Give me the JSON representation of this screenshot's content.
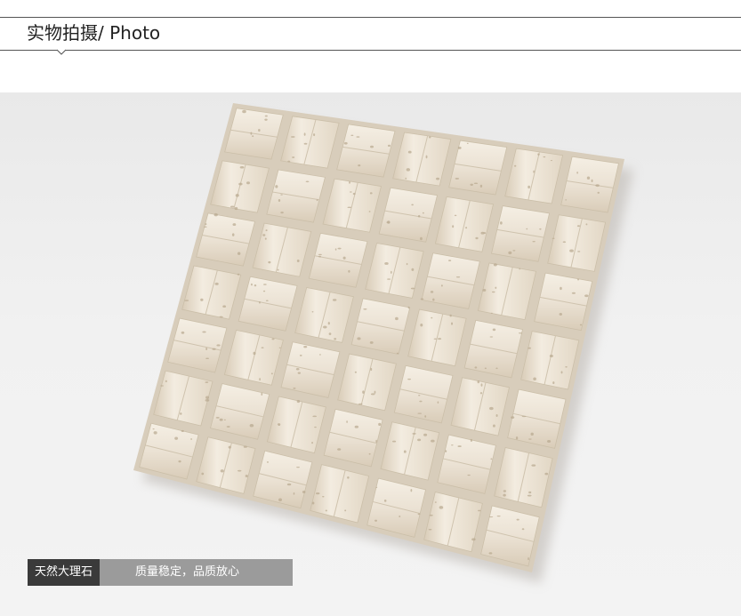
{
  "header": {
    "title": "实物拍摄/ Photo"
  },
  "photo": {
    "subject": "travertine-mosaic-tile-sheet"
  },
  "caption": {
    "tag": "天然大理石",
    "text": "质量稳定，品质放心"
  },
  "colors": {
    "rule": "#555555",
    "tile": "#ebe2d4",
    "tile_shade": "#d6cab6",
    "caption_dark": "#3a3a3a"
  }
}
